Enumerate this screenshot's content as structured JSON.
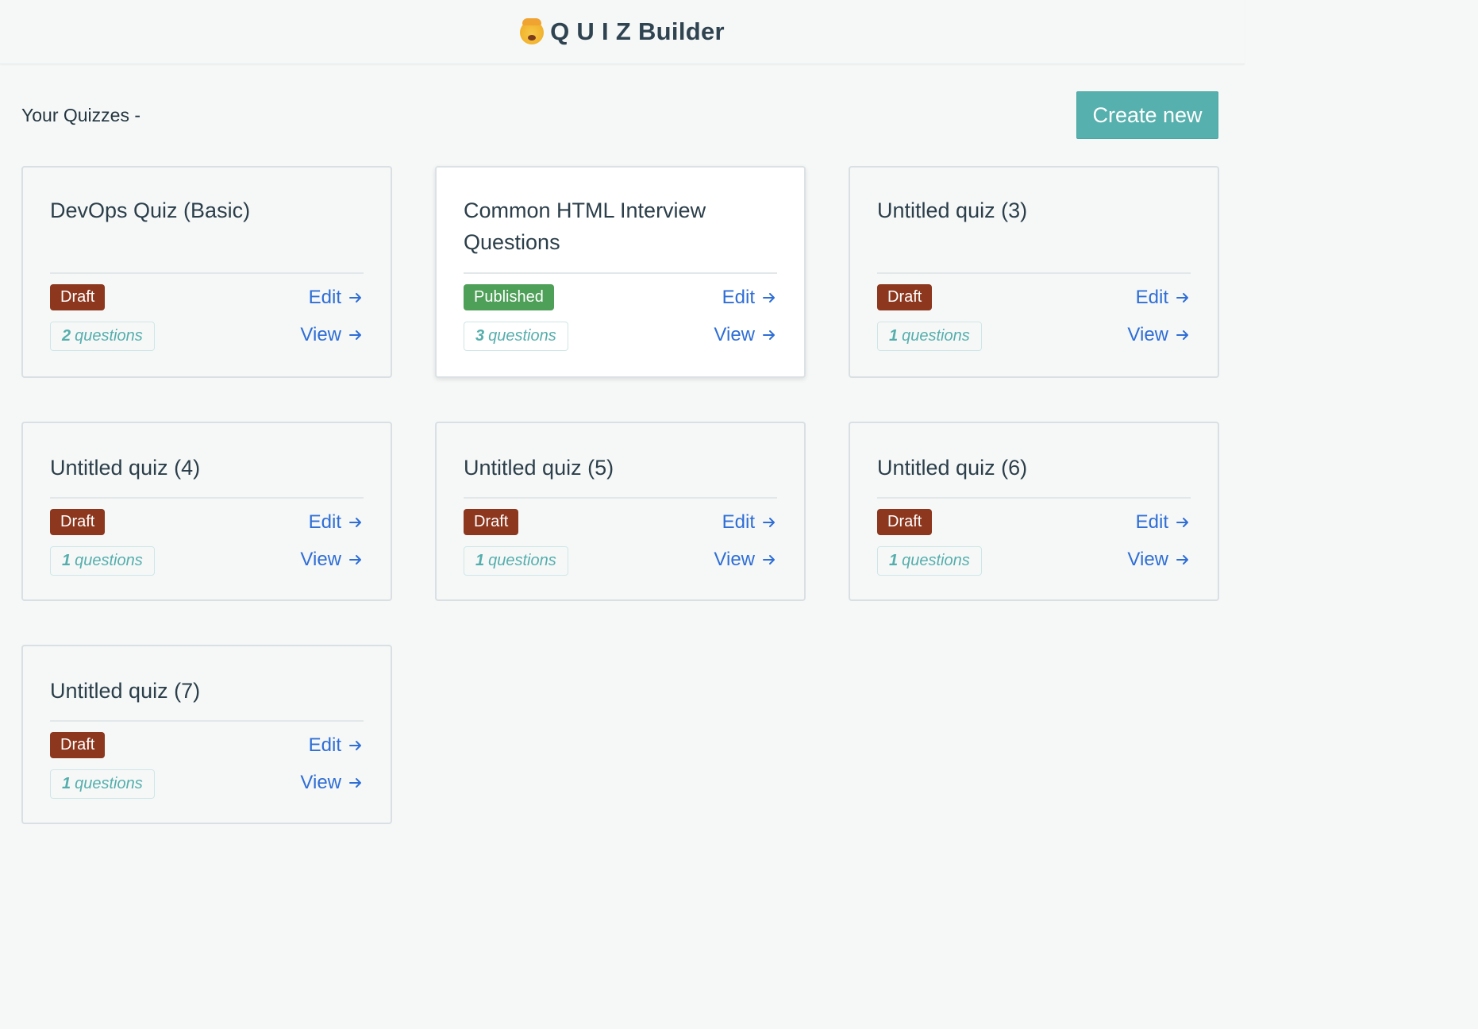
{
  "app": {
    "title": "Q U I Z Builder",
    "emoji_icon": "exploding-head-icon"
  },
  "page": {
    "subtitle": "Your Quizzes -",
    "create_button": "Create new"
  },
  "links": {
    "edit": "Edit",
    "view": "View"
  },
  "colors": {
    "accent": "#56b0ad",
    "link": "#2f6ed5",
    "draft": "#8c371e",
    "published": "#4e9f57"
  },
  "quizzes": [
    {
      "title": "DevOps Quiz (Basic)",
      "status": "Draft",
      "count": "2",
      "count_label": "questions"
    },
    {
      "title": "Common HTML Interview Questions",
      "status": "Published",
      "count": "3",
      "count_label": "questions"
    },
    {
      "title": "Untitled quiz (3)",
      "status": "Draft",
      "count": "1",
      "count_label": "questions"
    },
    {
      "title": "Untitled quiz (4)",
      "status": "Draft",
      "count": "1",
      "count_label": "questions"
    },
    {
      "title": "Untitled quiz (5)",
      "status": "Draft",
      "count": "1",
      "count_label": "questions"
    },
    {
      "title": "Untitled quiz (6)",
      "status": "Draft",
      "count": "1",
      "count_label": "questions"
    },
    {
      "title": "Untitled quiz (7)",
      "status": "Draft",
      "count": "1",
      "count_label": "questions"
    }
  ]
}
